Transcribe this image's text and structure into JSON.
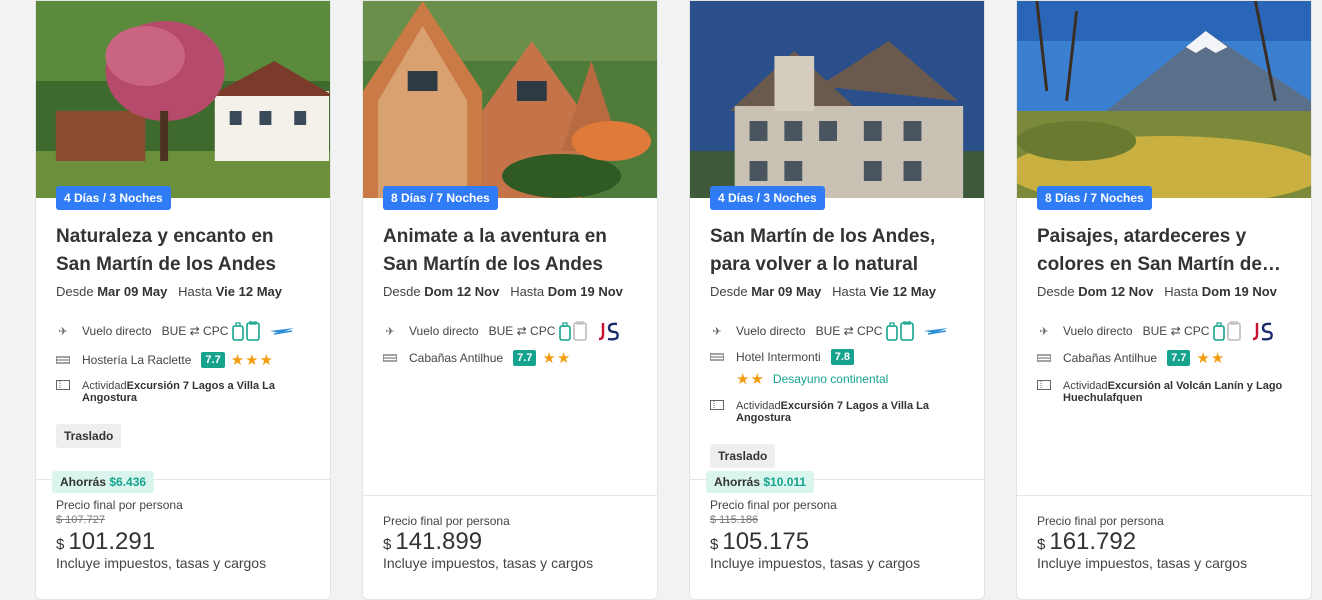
{
  "cards": [
    {
      "nights": "4 Días / 3 Noches",
      "title": "Naturaleza y encanto en San Martín de los Andes",
      "from_label": "Desde",
      "from_date": "Mar 09 May",
      "to_label": "Hasta",
      "to_date": "Vie 12 May",
      "flight_label": "Vuelo directo",
      "origin": "BUE",
      "destination": "CPC",
      "hotel": "Hostería La Raclette",
      "score": "7.7",
      "stars": "★★★",
      "activity_prefix": "Actividad",
      "activity": "Excursión 7 Lagos a Villa La Angostura",
      "transfer": "Traslado",
      "savings_label": "Ahorrás",
      "savings_value": "$6.436",
      "price_label": "Precio final por persona",
      "old_price": "$ 107.727",
      "currency": "$",
      "price": "101.291",
      "price_note": "Incluye impuestos, tasas y cargos"
    },
    {
      "nights": "8 Días / 7 Noches",
      "title": "Animate a la aventura en San Martín de los Andes",
      "from_label": "Desde",
      "from_date": "Dom 12 Nov",
      "to_label": "Hasta",
      "to_date": "Dom 19 Nov",
      "flight_label": "Vuelo directo",
      "origin": "BUE",
      "destination": "CPC",
      "hotel": "Cabañas Antilhue",
      "score": "7.7",
      "stars": "★★",
      "price_label": "Precio final por persona",
      "currency": "$",
      "price": "141.899",
      "price_note": "Incluye impuestos, tasas y cargos"
    },
    {
      "nights": "4 Días / 3 Noches",
      "title": "San Martín de los Andes, para volver a lo natural",
      "from_label": "Desde",
      "from_date": "Mar 09 May",
      "to_label": "Hasta",
      "to_date": "Vie 12 May",
      "flight_label": "Vuelo directo",
      "origin": "BUE",
      "destination": "CPC",
      "hotel": "Hotel Intermonti",
      "score": "7.8",
      "stars": "★★",
      "meal": "Desayuno continental",
      "activity_prefix": "Actividad",
      "activity": "Excursión 7 Lagos a Villa La Angostura",
      "transfer": "Traslado",
      "savings_label": "Ahorrás",
      "savings_value": "$10.011",
      "price_label": "Precio final por persona",
      "old_price": "$ 115.186",
      "currency": "$",
      "price": "105.175",
      "price_note": "Incluye impuestos, tasas y cargos"
    },
    {
      "nights": "8 Días / 7 Noches",
      "title": "Paisajes, atardeceres y colores en San Martín de los Andes",
      "from_label": "Desde",
      "from_date": "Dom 12 Nov",
      "to_label": "Hasta",
      "to_date": "Dom 19 Nov",
      "flight_label": "Vuelo directo",
      "origin": "BUE",
      "destination": "CPC",
      "hotel": "Cabañas Antilhue",
      "score": "7.7",
      "stars": "★★",
      "activity_prefix": "Actividad",
      "activity": "Excursión al Volcán Lanín y Lago Huechulafquen",
      "price_label": "Precio final por persona",
      "currency": "$",
      "price": "161.792",
      "price_note": "Incluye impuestos, tasas y cargos"
    }
  ],
  "icons": {
    "flight": "airplane-icon",
    "hotel": "bed-icon",
    "activity": "ticket-icon",
    "baggage": "baggage-icon",
    "route": "route-arrows-icon",
    "airline_a": "aerolineas-logo",
    "airline_b": "jetsmart-logo"
  },
  "colors": {
    "accent_blue": "#2f7cf6",
    "score_green": "#15a38e",
    "star_orange": "#f39c12",
    "savings_bg": "#d9f5ed"
  }
}
